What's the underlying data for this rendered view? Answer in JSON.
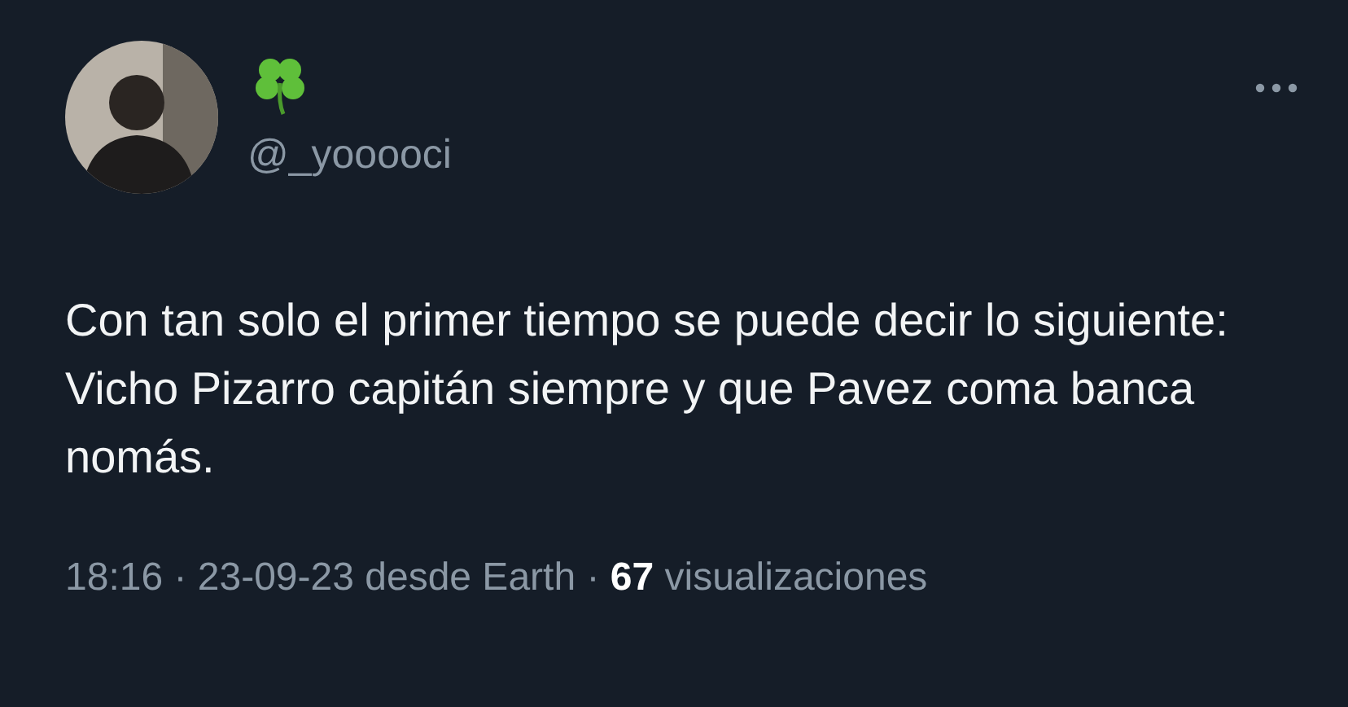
{
  "author": {
    "handle": "@_yooooci"
  },
  "tweet": {
    "text": "Con tan solo el primer tiempo se puede decir lo siguiente: Vicho Pizarro capitán siempre y que Pavez coma banca nomás."
  },
  "meta": "18:16 · 23-09-23 desde Earth · **67** visualizaciones"
}
